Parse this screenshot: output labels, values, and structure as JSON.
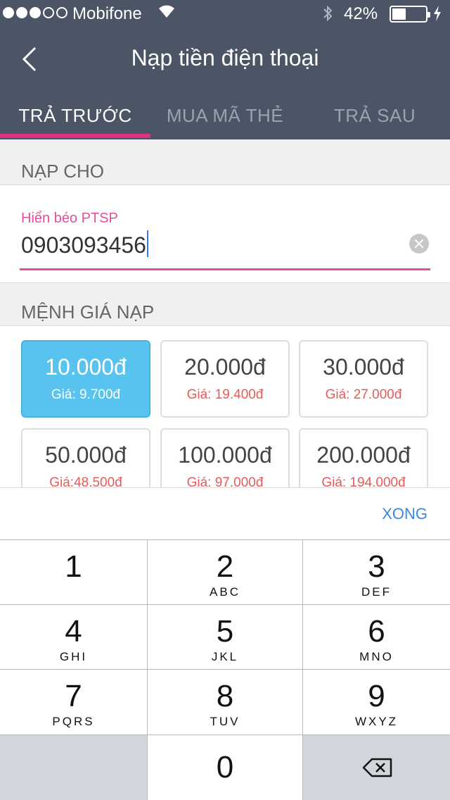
{
  "status": {
    "carrier": "Mobifone",
    "battery": "42%",
    "battery_level": 0.42
  },
  "nav": {
    "title": "Nạp tiền điện thoại"
  },
  "tabs": [
    {
      "label": "TRẢ TRƯỚC"
    },
    {
      "label": "MUA MÃ THẺ"
    },
    {
      "label": "TRẢ SAU"
    }
  ],
  "recipient": {
    "section_label": "NẠP CHO",
    "contact_name": "Hiển béo PTSP",
    "phone": "0903093456"
  },
  "denominations": {
    "section_label": "MỆNH GIÁ NẠP",
    "options": [
      {
        "amount": "10.000đ",
        "price": "Giá: 9.700đ",
        "selected": true
      },
      {
        "amount": "20.000đ",
        "price": "Giá: 19.400đ"
      },
      {
        "amount": "30.000đ",
        "price": "Giá: 27.000đ"
      },
      {
        "amount": "50.000đ",
        "price": "Giá:48.500đ"
      },
      {
        "amount": "100.000đ",
        "price": "Giá: 97.000đ"
      },
      {
        "amount": "200.000đ",
        "price": "Giá: 194.000đ"
      }
    ]
  },
  "keyboard": {
    "done_label": "XONG",
    "keys": [
      {
        "digit": "1",
        "letters": ""
      },
      {
        "digit": "2",
        "letters": "ABC"
      },
      {
        "digit": "3",
        "letters": "DEF"
      },
      {
        "digit": "4",
        "letters": "GHI"
      },
      {
        "digit": "5",
        "letters": "JKL"
      },
      {
        "digit": "6",
        "letters": "MNO"
      },
      {
        "digit": "7",
        "letters": "PQRS"
      },
      {
        "digit": "8",
        "letters": "TUV"
      },
      {
        "digit": "9",
        "letters": "WXYZ"
      },
      {
        "digit": "0",
        "letters": ""
      }
    ]
  },
  "colors": {
    "header": "#4c5566",
    "accent": "#e0317e",
    "selected": "#58c3ef",
    "price": "#e85a5a",
    "link": "#3a88e0"
  }
}
